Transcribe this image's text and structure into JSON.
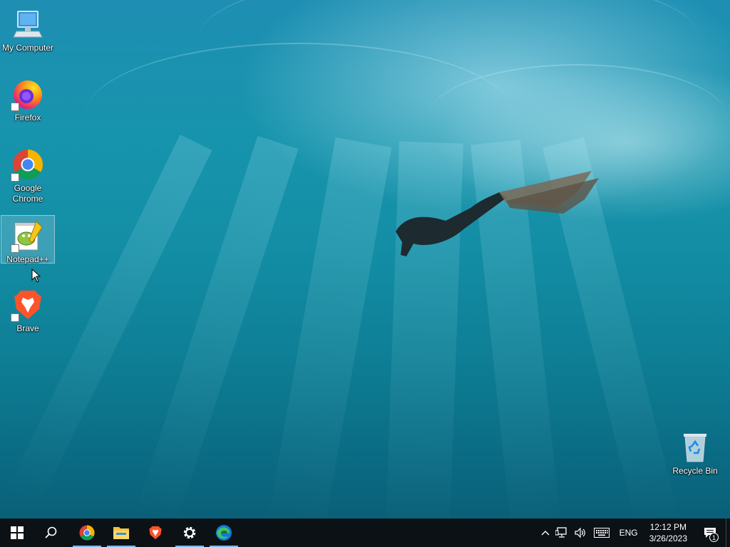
{
  "desktop": {
    "icons": [
      {
        "label": "My Computer",
        "icon": "computer-icon",
        "shortcut": false
      },
      {
        "label": "Firefox",
        "icon": "firefox-icon",
        "shortcut": true
      },
      {
        "label": "Google Chrome",
        "icon": "chrome-icon",
        "shortcut": true
      },
      {
        "label": "Notepad++",
        "icon": "notepad-plus-plus-icon",
        "shortcut": true,
        "selected": true
      },
      {
        "label": "Brave",
        "icon": "brave-icon",
        "shortcut": true
      }
    ],
    "recycle_bin": {
      "label": "Recycle Bin",
      "icon": "recycle-bin-icon"
    }
  },
  "taskbar": {
    "start": {
      "icon": "windows-start-icon"
    },
    "search": {
      "icon": "search-icon"
    },
    "pinned": [
      {
        "name": "Google Chrome",
        "icon": "chrome-icon",
        "active": true
      },
      {
        "name": "File Explorer",
        "icon": "folder-icon",
        "active": true
      },
      {
        "name": "Brave",
        "icon": "brave-icon",
        "active": false
      },
      {
        "name": "Settings",
        "icon": "gear-icon",
        "active": true
      },
      {
        "name": "Microsoft Edge",
        "icon": "edge-icon",
        "active": true
      }
    ],
    "tray": {
      "language": "ENG",
      "time": "12:12 PM",
      "date": "3/26/2023",
      "notification_count": "1"
    }
  },
  "colors": {
    "taskbar_bg": "#0c1116",
    "active_indicator": "#76b9ed",
    "water_top": "#1e8fb3",
    "water_bottom": "#085a72"
  }
}
